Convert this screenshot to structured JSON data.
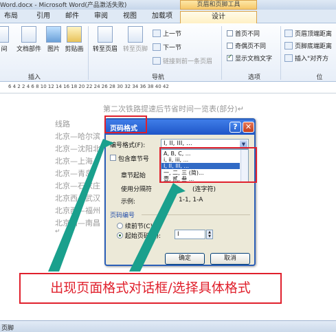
{
  "window": {
    "title": "Word.docx - Microsoft Word(产品激活失败)",
    "context_tab_header": "页眉和页脚工具"
  },
  "tabs": [
    "布局",
    "引用",
    "邮件",
    "审阅",
    "视图",
    "加载项",
    "设计"
  ],
  "ribbon": {
    "insert_group": {
      "label": "插入",
      "buttons": [
        "间",
        "文档部件",
        "图片",
        "剪贴画"
      ]
    },
    "nav_group": {
      "label": "导航",
      "goto_header": "转至页眉",
      "goto_footer": "转至页脚",
      "prev_section": "上一节",
      "next_section": "下一节",
      "link_prev": "链接到前一条页眉"
    },
    "options_group": {
      "label": "选项",
      "first_page_diff": "首页不同",
      "odd_even_diff": "奇偶页不同",
      "show_doc_text": "显示文档文字"
    },
    "position_group": {
      "label": "位",
      "header_top": "页眉顶端距离",
      "footer_bottom": "页脚底端距离",
      "insert_align": "插入\"对齐方"
    }
  },
  "ruler": {
    "numbers": "6  4  2      2  4  6  8  10  12  14  16  18  20  22  24  26  28  30  32  34  36  38  40  42"
  },
  "document": {
    "title": "第二次铁路提速后节省时间一览表(部分)↵",
    "lines": [
      "线路",
      "北京—哈尔滨",
      "北京—沈阳北",
      "北京—上海",
      "北京—青岛",
      "北京—石家庄",
      "北京西—武汉",
      "北京西—福州",
      "北京西—南昌",
      "↵"
    ]
  },
  "dialog": {
    "title": "页码格式",
    "number_format_label": "编号格式(F):",
    "number_format_value": "I, II, III, ...",
    "include_chapter": "包含章节号",
    "chapter_start_style": "章节起始",
    "separator": "使用分隔符",
    "separator_value": "(连字符)",
    "example": "示例:",
    "example_value": "1-1, 1-A",
    "list_options": [
      "A, B, C, ...",
      "i, ii, iii, ...",
      "I, II, III, ...",
      "一, 二, 三 (简)...",
      "壹, 贰, 叁 ..."
    ],
    "page_numbering": "页码编号",
    "continue_prev": "续前节(C)",
    "start_at": "起始页码(A):",
    "start_value": "I",
    "ok": "确定",
    "cancel": "取消"
  },
  "callout": "出现页面格式对话框/选择具体格式",
  "status": {
    "text": "页脚"
  }
}
